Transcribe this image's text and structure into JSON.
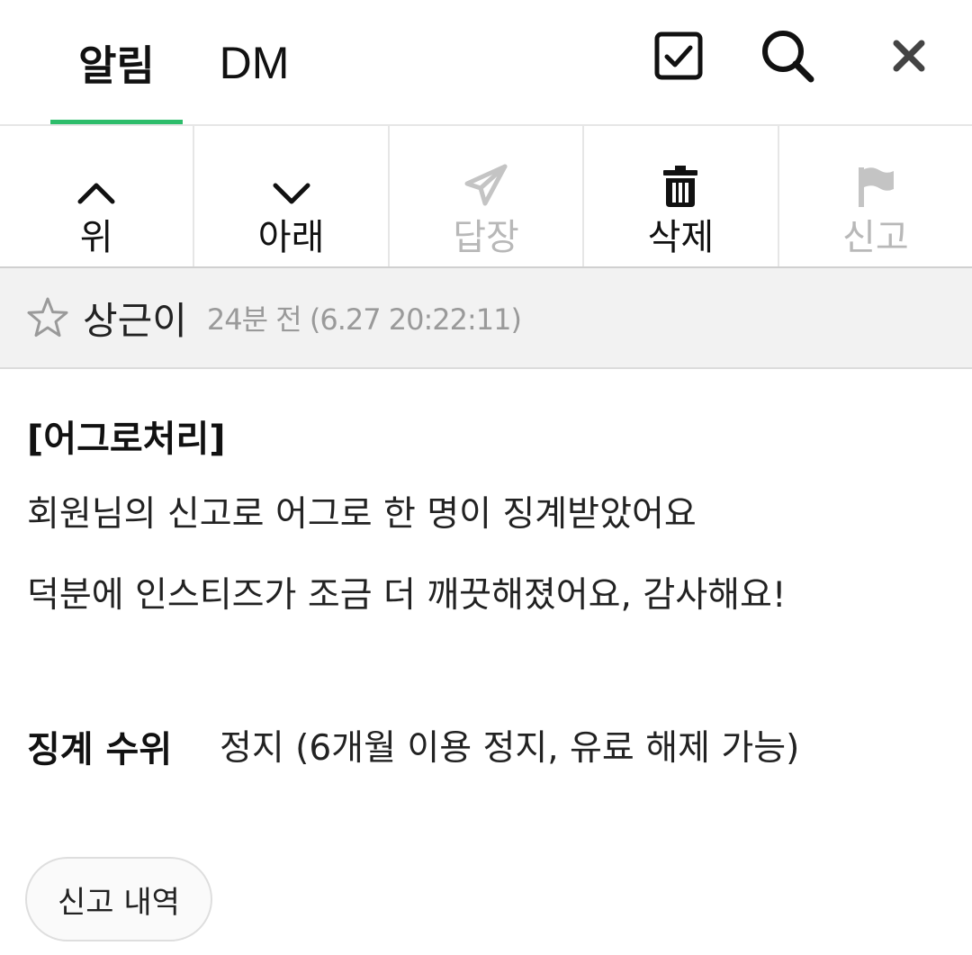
{
  "header": {
    "tabs": [
      {
        "label": "알림",
        "active": true
      },
      {
        "label": "DM",
        "active": false
      }
    ],
    "icons": [
      "checkbox-icon",
      "search-icon",
      "close-icon"
    ]
  },
  "toolbar": {
    "items": [
      {
        "label": "위",
        "icon": "chevron-up-icon",
        "enabled": true
      },
      {
        "label": "아래",
        "icon": "chevron-down-icon",
        "enabled": true
      },
      {
        "label": "답장",
        "icon": "paper-plane-icon",
        "enabled": false
      },
      {
        "label": "삭제",
        "icon": "trash-icon",
        "enabled": true
      },
      {
        "label": "신고",
        "icon": "flag-icon",
        "enabled": false
      }
    ]
  },
  "message": {
    "sender": "상근이",
    "time": "24분 전 (6.27 20:22:11)",
    "title": "[어그로처리]",
    "lines": [
      "회원님의 신고로 어그로 한 명이 징계받았어요",
      "덕분에 인스티즈가 조금 더 깨끗해졌어요, 감사해요!"
    ],
    "penalty_label": "징계 수위",
    "penalty_value": "정지 (6개월 이용 정지, 유료 해제 가능)",
    "report_history_button": "신고 내역"
  },
  "colors": {
    "accent": "#2dbd6b",
    "disabled": "#b8b8b8",
    "sender_bar": "#f2f2f2"
  }
}
